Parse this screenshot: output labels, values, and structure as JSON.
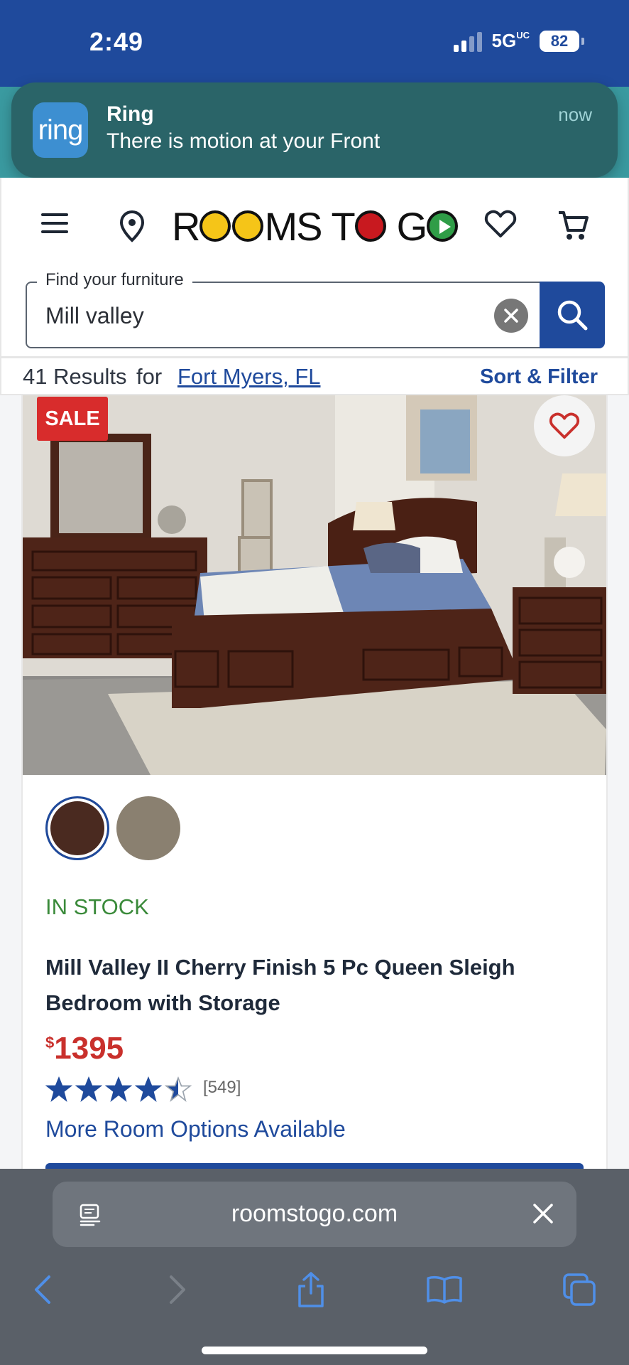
{
  "status_bar": {
    "time": "2:49",
    "network": "5G",
    "network_suffix": "UC",
    "battery": "82"
  },
  "notification": {
    "app": "Ring",
    "logo_text": "ring",
    "message": "There is motion at your Front",
    "time": "now"
  },
  "header": {
    "logo_text": "ROOMS TO GO"
  },
  "search": {
    "label": "Find your furniture",
    "value": "Mill valley"
  },
  "results": {
    "count_text": "41 Results",
    "for_text": "for",
    "location": "Fort Myers, FL",
    "sort_filter": "Sort & Filter"
  },
  "product": {
    "badge": "SALE",
    "stock": "IN STOCK",
    "title": "Mill Valley II Cherry Finish 5 Pc Queen Sleigh Bedroom with Storage",
    "price_currency": "$",
    "price": "1395",
    "rating": 4.5,
    "review_count": "[549]",
    "more_options": "More Room Options Available",
    "swatches": [
      {
        "name": "cherry",
        "color": "#4a2a20"
      },
      {
        "name": "gray",
        "color": "#8a8070"
      }
    ]
  },
  "browser": {
    "url": "roomstogo.com"
  },
  "colors": {
    "brand_blue": "#1f4a9c",
    "sale_red": "#d82c2c",
    "price_red": "#c9302c",
    "stock_green": "#3a8a3a"
  }
}
